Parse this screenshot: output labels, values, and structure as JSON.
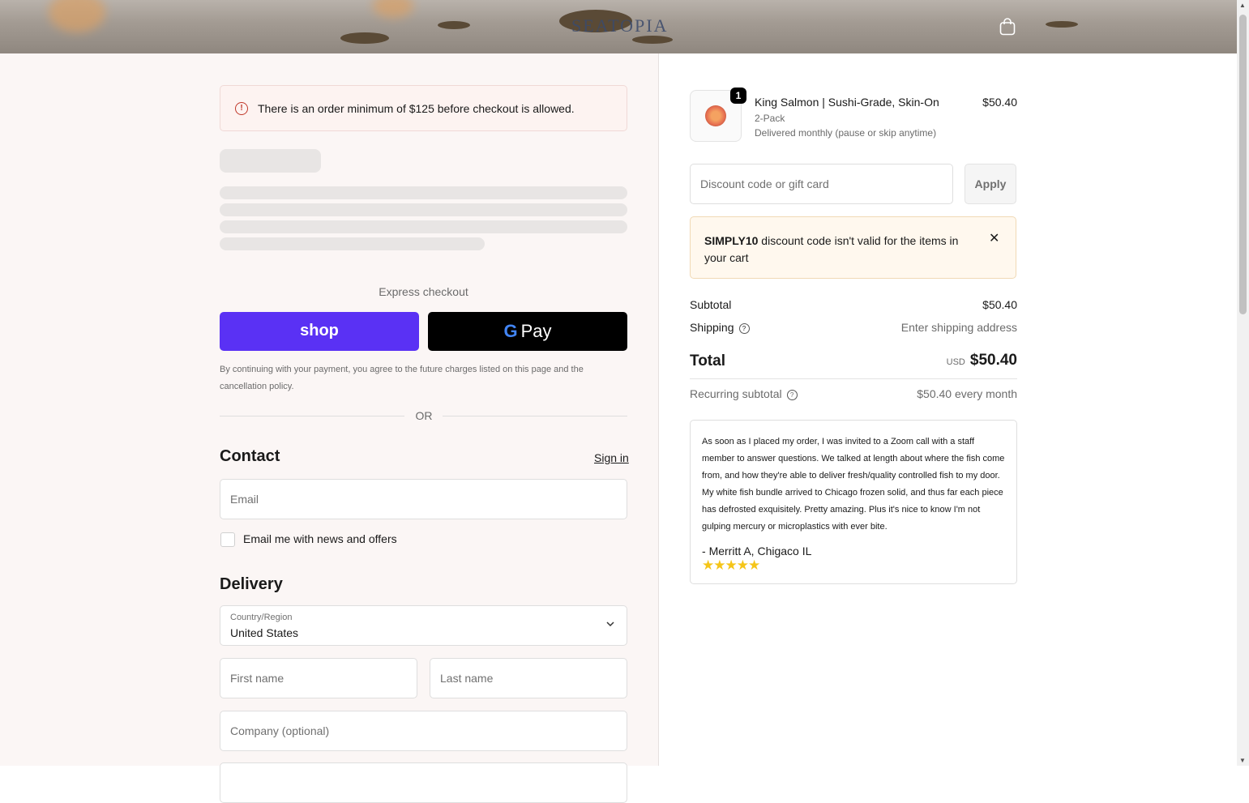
{
  "header": {
    "logo": "SEATOPIA",
    "cart_icon": "shopping-bag-icon"
  },
  "banner": {
    "icon": "alert-circle-icon",
    "text": "There is an order minimum of $125 before checkout is allowed."
  },
  "express": {
    "label": "Express checkout",
    "shop_label": "shop",
    "gpay_g": "G",
    "gpay_label": "Pay",
    "terms": "By continuing with your payment, you agree to the future charges listed on this page and the cancellation policy.",
    "or": "OR"
  },
  "contact": {
    "title": "Contact",
    "sign_in": "Sign in",
    "email_placeholder": "Email",
    "newsletter_label": "Email me with news and offers"
  },
  "delivery": {
    "title": "Delivery",
    "country_label": "Country/Region",
    "country_value": "United States",
    "first_name_placeholder": "First name",
    "last_name_placeholder": "Last name",
    "company_placeholder": "Company (optional)"
  },
  "order": {
    "quantity_badge": "1",
    "product_title": "King Salmon | Sushi-Grade, Skin-On",
    "product_variant": "2-Pack",
    "product_delivery": "Delivered monthly (pause or skip anytime)",
    "product_price": "$50.40",
    "discount_placeholder": "Discount code or gift card",
    "apply_label": "Apply",
    "warning_code": "SIMPLY10",
    "warning_text": " discount code isn't valid for the items in your cart",
    "subtotal_label": "Subtotal",
    "subtotal_value": "$50.40",
    "shipping_label": "Shipping",
    "shipping_value": "Enter shipping address",
    "total_label": "Total",
    "currency": "USD",
    "total_value": "$50.40",
    "recurring_label": "Recurring subtotal",
    "recurring_value": "$50.40 every month"
  },
  "review": {
    "quote": "As soon as I placed my order, I was invited to a Zoom call with a staff member to answer questions. We talked at length about where the fish come from, and how they're able to deliver fresh/quality controlled fish to my door. My white fish bundle arrived to Chicago frozen solid, and thus far each piece has defrosted exquisitely. Pretty amazing. Plus it's nice to know I'm not gulping mercury or microplastics with ever bite.",
    "author_prefix": "- ",
    "author": "Merritt A, Chigaco IL",
    "stars": "★★★★★"
  }
}
